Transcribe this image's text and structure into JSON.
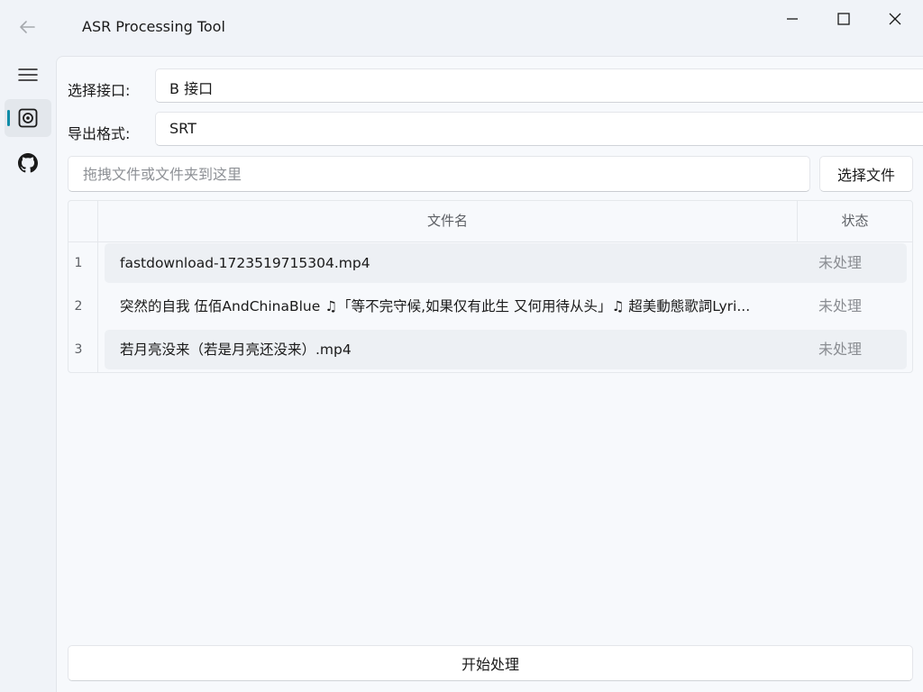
{
  "window": {
    "title": "ASR Processing Tool"
  },
  "sidebar": {
    "items": [
      {
        "icon": "hamburger-menu-icon"
      },
      {
        "icon": "asr-record-icon",
        "selected": true
      },
      {
        "icon": "github-icon"
      }
    ],
    "accent": "#0f8ca8"
  },
  "form": {
    "interface_label": "选择接口:",
    "interface_value": "B 接口",
    "format_label": "导出格式:",
    "format_value": "SRT",
    "drop_placeholder": "拖拽文件或文件夹到这里",
    "select_file_label": "选择文件"
  },
  "table": {
    "headers": {
      "name": "文件名",
      "status": "状态"
    },
    "rows": [
      {
        "index": "1",
        "name": "fastdownload-1723519715304.mp4",
        "status": "未处理"
      },
      {
        "index": "2",
        "name": "突然的自我 伍佰AndChinaBlue ♫「等不完守候,如果仅有此生 又何用待从头」♫ 超美動態歌詞Lyri...",
        "status": "未处理"
      },
      {
        "index": "3",
        "name": "若月亮没来（若是月亮还没来）.mp4",
        "status": "未处理"
      }
    ]
  },
  "actions": {
    "start_label": "开始处理"
  }
}
